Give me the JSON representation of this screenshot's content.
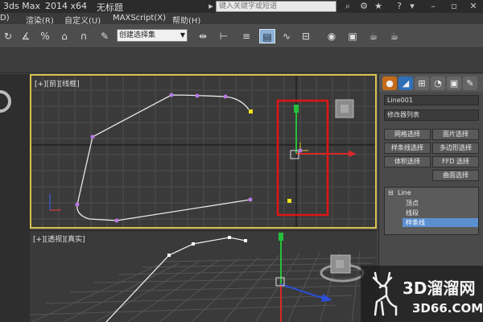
{
  "title_bar": {
    "app_name": "3ds Max",
    "version": "2014 x64",
    "document": "无标题",
    "search_placeholder": "键入关键字或短语"
  },
  "menu": {
    "items": [
      "D)",
      "渲染(R)",
      "自定义(U)",
      "MAXScript(X)",
      "帮助(H)"
    ]
  },
  "toolbar": {
    "selection_set": "创建选择集"
  },
  "viewports": {
    "top_label": "[+][前][线框]",
    "persp_label": "[+][透视][真实]"
  },
  "command_panel": {
    "object_name": "Line001",
    "modifier_list": "修改器列表",
    "buttons": [
      "网格选择",
      "面片选择",
      "样条线选择",
      "多边形选择",
      "体积选择",
      "FFD 选择",
      "曲面选择"
    ],
    "stack": {
      "base": "Line",
      "sub_vertex": "顶点",
      "sub_segment": "线段",
      "sub_spline": "样条线"
    }
  },
  "watermark": {
    "line1": "3D溜溜网",
    "line2": "3D66.COM"
  },
  "colors": {
    "active_viewport_border": "#d7c24f",
    "highlight_rect": "#e01515",
    "spline": "#e8e8e8",
    "vertex": "#b77be6",
    "stack_selected": "#5b8fd0"
  }
}
